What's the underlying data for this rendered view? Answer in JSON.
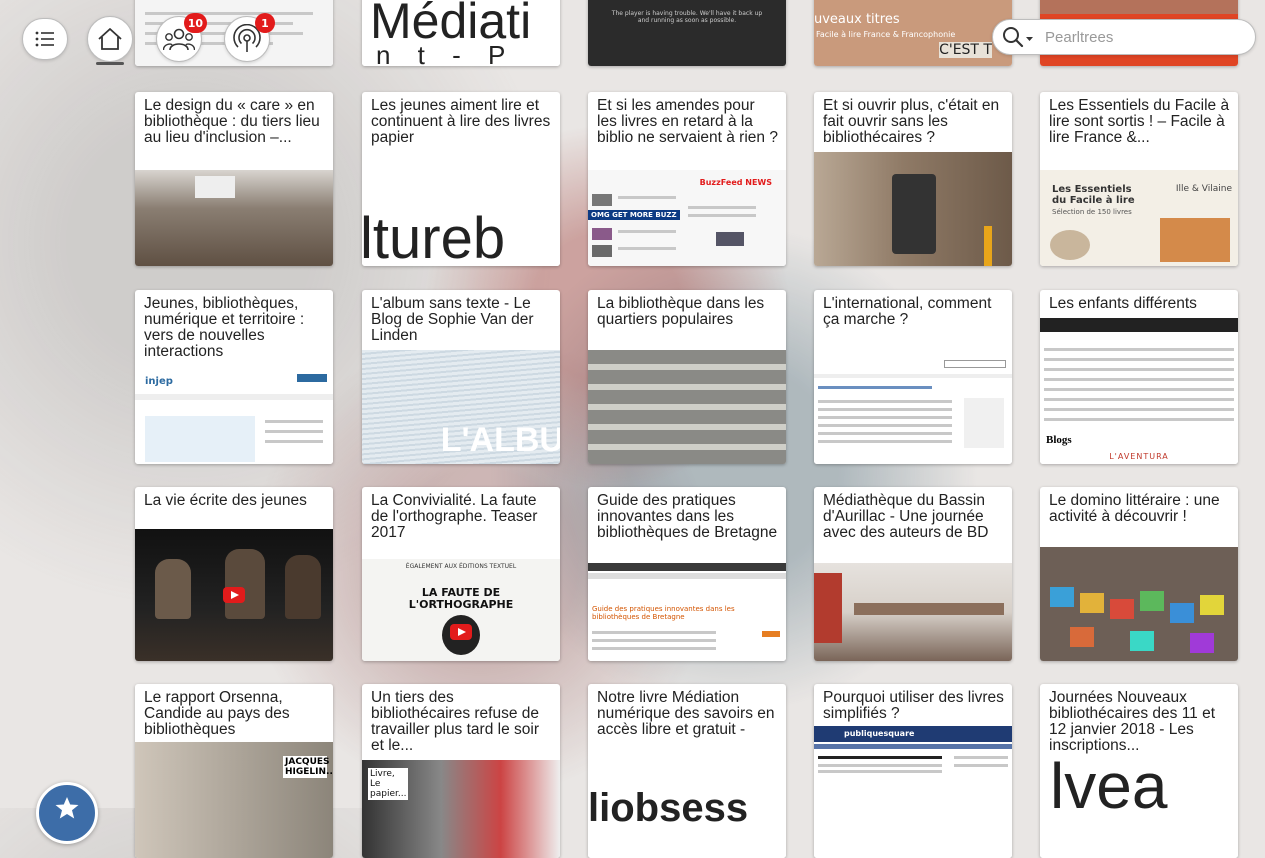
{
  "search": {
    "placeholder": "Pearltrees"
  },
  "notifications": {
    "team_count": "10",
    "activity_count": "1"
  },
  "top_fragments": [
    "Médiati",
    "n t - P",
    "The player is having trouble. We'll have it back up and running as soon as possible.",
    "uveaux titres",
    "Facile à lire France & Francophonie",
    "C'EST T"
  ],
  "cards": [
    {
      "title": "Le design du « care » en bibliothèque : du tiers lieu au lieu d'inclusion –..."
    },
    {
      "title": "Les jeunes aiment lire et continuent à lire des livres papier",
      "thumb_text": "ltureb"
    },
    {
      "title": "Et si les amendes pour les livres en retard à la biblio ne servaient à rien ?",
      "thumb_text": "BuzzFeed NEWS",
      "thumb_text2": "OMG GET MORE BUZZ"
    },
    {
      "title": "Et si ouvrir plus, c'était en fait ouvrir sans les bibliothécaires ?"
    },
    {
      "title": "Les Essentiels du Facile à lire sont sortis ! – Facile à lire France &...",
      "thumb_text": "Les Essentiels du Facile à lire",
      "thumb_text2": "Sélection de 150 livres",
      "thumb_text3": "Ille & Vilaine"
    },
    {
      "title": "Jeunes, bibliothèques, numérique et territoire : vers de nouvelles interactions",
      "thumb_text": "injep"
    },
    {
      "title": "L'album sans texte - Le Blog de Sophie Van der Linden",
      "thumb_text": "L'ALBU"
    },
    {
      "title": "La bibliothèque dans les quartiers populaires"
    },
    {
      "title": "L'international, comment ça marche ?"
    },
    {
      "title": "Les enfants différents",
      "thumb_text": "Blogs",
      "thumb_text2": "L'AVENTURA"
    },
    {
      "title": "La vie écrite des jeunes"
    },
    {
      "title": "La Convivialité. La faute de l'orthographe. Teaser 2017",
      "thumb_text": "ÉGALEMENT AUX ÉDITIONS TEXTUEL",
      "thumb_text2": "LA FAUTE DE L'ORTHOGRAPHE"
    },
    {
      "title": "Guide des pratiques innovantes dans les bibliothèques de Bretagne",
      "thumb_text": "Guide des pratiques innovantes dans les bibliothèques de Bretagne"
    },
    {
      "title": "Médiathèque du Bassin d'Aurillac - Une journée avec des auteurs de BD"
    },
    {
      "title": "Le domino littéraire : une activité à découvrir !"
    },
    {
      "title": "Le rapport Orsenna, Candide au pays des bibliothèques",
      "thumb_text": "JACQUES HIGELIN..."
    },
    {
      "title": "Un tiers des bibliothécaires refuse de travailler plus tard le soir et le...",
      "thumb_text": "Livre, Le papier..."
    },
    {
      "title": "Notre livre Médiation numérique des savoirs en accès libre et gratuit -",
      "thumb_text": "liobsess"
    },
    {
      "title": "Pourquoi utiliser des livres simplifiés ?",
      "thumb_text": "publiquesquare"
    },
    {
      "title": "Journées Nouveaux bibliothécaires des 11 et 12 janvier 2018 - Les inscriptions...",
      "thumb_text": "lvea"
    }
  ]
}
